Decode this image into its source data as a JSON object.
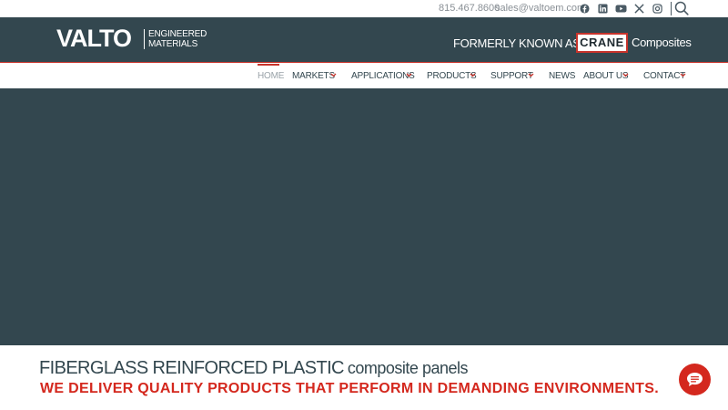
{
  "topbar": {
    "phone": "815.467.8600",
    "email": "sales@valtoem.com",
    "social": [
      "facebook-icon",
      "linkedin-icon",
      "youtube-icon",
      "x-icon",
      "instagram-icon"
    ]
  },
  "brand": {
    "logo_word": "VALTO",
    "logo_sub_line1": "ENGINEERED",
    "logo_sub_line2": "MATERIALS",
    "formerly": "FORMERLY KNOWN AS",
    "crane": "CRANE",
    "composites": "Composites"
  },
  "nav": {
    "items": [
      {
        "label": "HOME",
        "dropdown": false,
        "active": true
      },
      {
        "label": "MARKETS",
        "dropdown": true
      },
      {
        "label": "APPLICATIONS",
        "dropdown": true
      },
      {
        "label": "PRODUCTS",
        "dropdown": true
      },
      {
        "label": "SUPPORT",
        "dropdown": true
      },
      {
        "label": "NEWS",
        "dropdown": false
      },
      {
        "label": "ABOUT US",
        "dropdown": true
      },
      {
        "label": "CONTACT",
        "dropdown": true
      }
    ]
  },
  "tagline": {
    "main": "FIBERGLASS REINFORCED PLASTIC",
    "secondary": "composite panels",
    "subhead": "WE DELIVER QUALITY PRODUCTS THAT PERFORM IN DEMANDING ENVIRONMENTS."
  },
  "colors": {
    "navy": "#33474f",
    "accent_red": "#d4281e",
    "gray_text": "#8a9096"
  }
}
